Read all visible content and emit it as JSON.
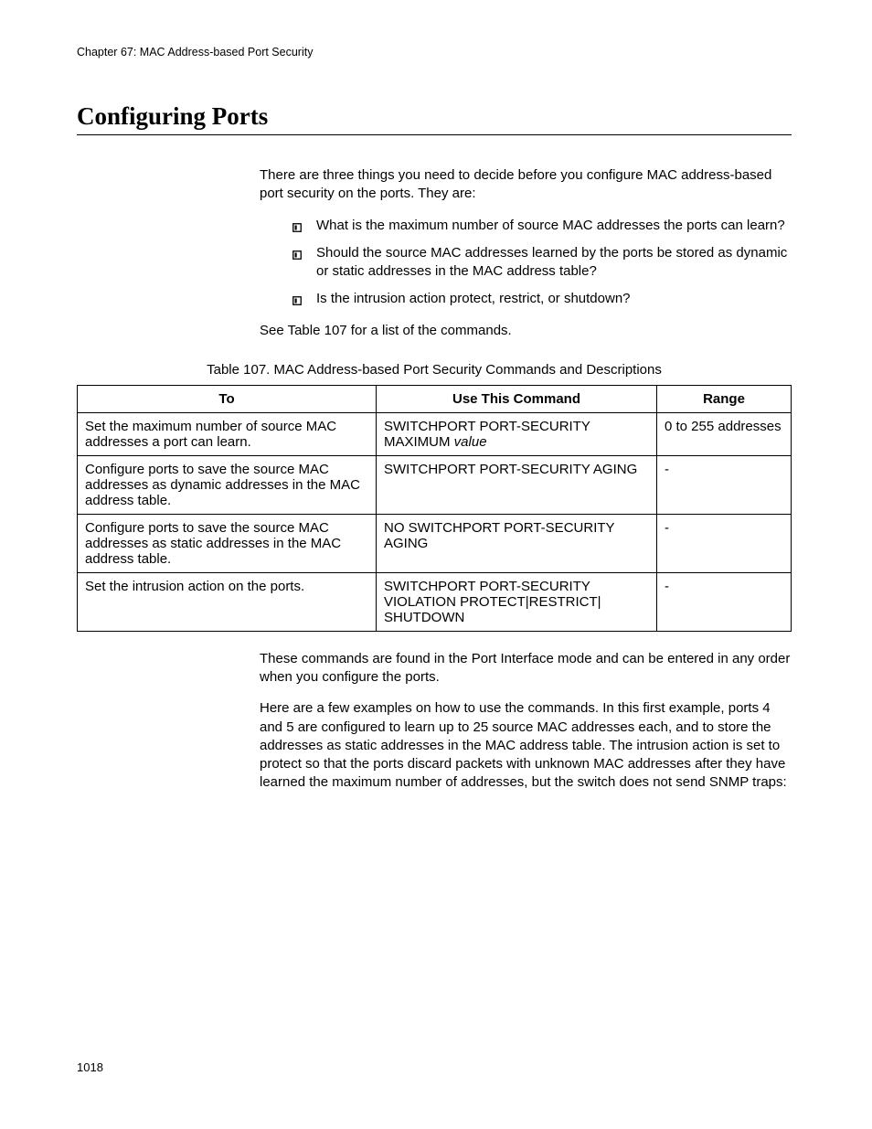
{
  "header": {
    "chapter_line": "Chapter 67: MAC Address-based Port Security"
  },
  "section": {
    "title": "Configuring Ports"
  },
  "intro": {
    "p1": "There are three things you need to decide before you configure MAC address-based port security on the ports. They are:",
    "bullets": [
      "What is the maximum number of source MAC addresses the ports can learn?",
      "Should the source MAC addresses learned by the ports be stored as dynamic or static addresses in the MAC address table?",
      "Is the intrusion action protect, restrict, or shutdown?"
    ],
    "see_line": "See Table 107 for a list of the commands."
  },
  "table": {
    "caption": "Table 107. MAC Address-based Port Security Commands and Descriptions",
    "headers": {
      "to": "To",
      "cmd": "Use This Command",
      "range": "Range"
    },
    "rows": [
      {
        "to": "Set the maximum number of source MAC addresses a port can learn.",
        "cmd_prefix": "SWITCHPORT PORT-SECURITY MAXIMUM ",
        "cmd_italic": "value",
        "range": "0 to 255 addresses"
      },
      {
        "to": "Configure ports to save the source MAC addresses as dynamic addresses in the MAC address table.",
        "cmd_prefix": "SWITCHPORT PORT-SECURITY AGING",
        "cmd_italic": "",
        "range": "-"
      },
      {
        "to": "Configure ports to save the source MAC addresses as static addresses in the MAC address table.",
        "cmd_prefix": "NO SWITCHPORT PORT-SECURITY AGING",
        "cmd_italic": "",
        "range": "-"
      },
      {
        "to": "Set the intrusion action on the ports.",
        "cmd_prefix": "SWITCHPORT PORT-SECURITY VIOLATION PROTECT|RESTRICT| SHUTDOWN",
        "cmd_italic": "",
        "range": "-"
      }
    ]
  },
  "after": {
    "p1": "These commands are found in the Port Interface mode and can be entered in any order when you configure the ports.",
    "p2": "Here are a few examples on how to use the commands. In this first example, ports 4 and 5 are configured to learn up to 25 source MAC addresses each, and to store the addresses as static addresses in the MAC address table. The intrusion action is set to protect so that the ports discard packets with unknown MAC addresses after they have learned the maximum number of addresses, but the switch does not send SNMP traps:"
  },
  "footer": {
    "page_number": "1018"
  }
}
